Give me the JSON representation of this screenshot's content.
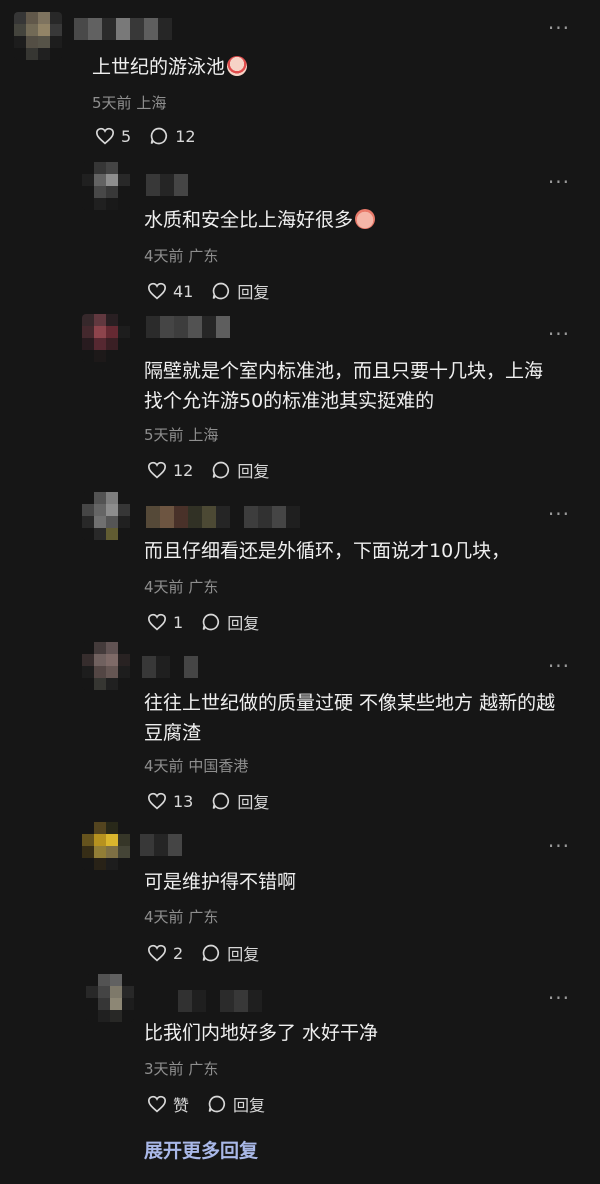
{
  "comments": [
    {
      "text": "上世纪的游泳池",
      "emoji": "clown-crying-emoji",
      "time": "5天前",
      "location": "上海",
      "likes": "5",
      "replies": "12"
    },
    {
      "text": "水质和安全比上海好很多",
      "emoji": "peach-face-emoji",
      "time": "4天前",
      "location": "广东",
      "likes": "41",
      "replies": "回复"
    },
    {
      "text_line1": "隔壁就是个室内标准池，而且只要十几块，上海",
      "text_line2": "找个允许游50的标准池其实挺难的",
      "time": "5天前",
      "location": "上海",
      "likes": "12",
      "replies": "回复"
    },
    {
      "text": "而且仔细看还是外循环，下面说才10几块，",
      "time": "4天前",
      "location": "广东",
      "likes": "1",
      "replies": "回复"
    },
    {
      "text_line1": "往往上世纪做的质量过硬 不像某些地方 越新的越",
      "text_line2": "豆腐渣",
      "time": "4天前",
      "location": "中国香港",
      "likes": "13",
      "replies": "回复"
    },
    {
      "text": "可是维护得不错啊",
      "time": "4天前",
      "location": "广东",
      "likes": "2",
      "replies": "回复"
    },
    {
      "text": "比我们内地好多了 水好干净",
      "time": "3天前",
      "location": "广东",
      "likes": "赞",
      "replies": "回复"
    }
  ],
  "more_icon": "···",
  "expand_label": "展开更多回复",
  "colors": {
    "background": "#161616",
    "text": "#efefef",
    "meta": "#8f8f8f",
    "expand": "#a9b8e8"
  }
}
